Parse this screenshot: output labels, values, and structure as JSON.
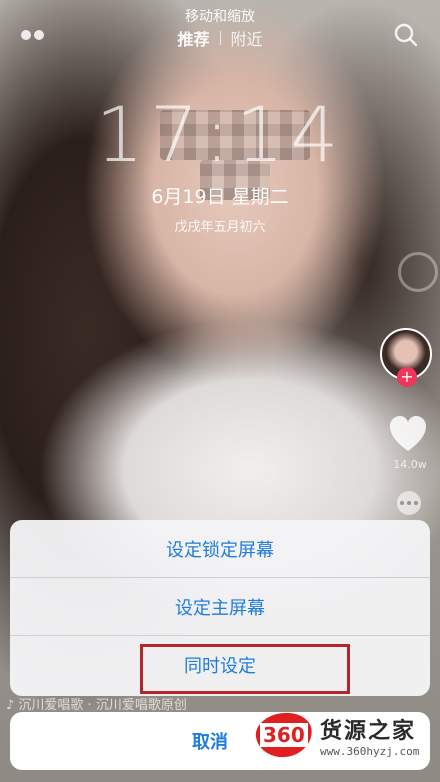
{
  "top_hint": "移动和缩放",
  "tabs": {
    "recommend": "推荐",
    "nearby": "附近"
  },
  "lockscreen": {
    "time": "17:14",
    "date": "6月19日 星期二",
    "lunar": "戊戌年五月初六"
  },
  "right_rail": {
    "like_count": "14.0w"
  },
  "music_caption": "♪ 沉川爱唱歌 · 沉川爱唱歌原创",
  "action_sheet": {
    "items": [
      "设定锁定屏幕",
      "设定主屏幕",
      "同时设定"
    ],
    "cancel": "取消"
  },
  "watermark": {
    "badge": "360",
    "name": "货源之家",
    "url": "www.360hyzj.com"
  },
  "colors": {
    "sheet_text": "#1f7de0",
    "highlight": "#b3262c",
    "follow": "#f0365a"
  }
}
